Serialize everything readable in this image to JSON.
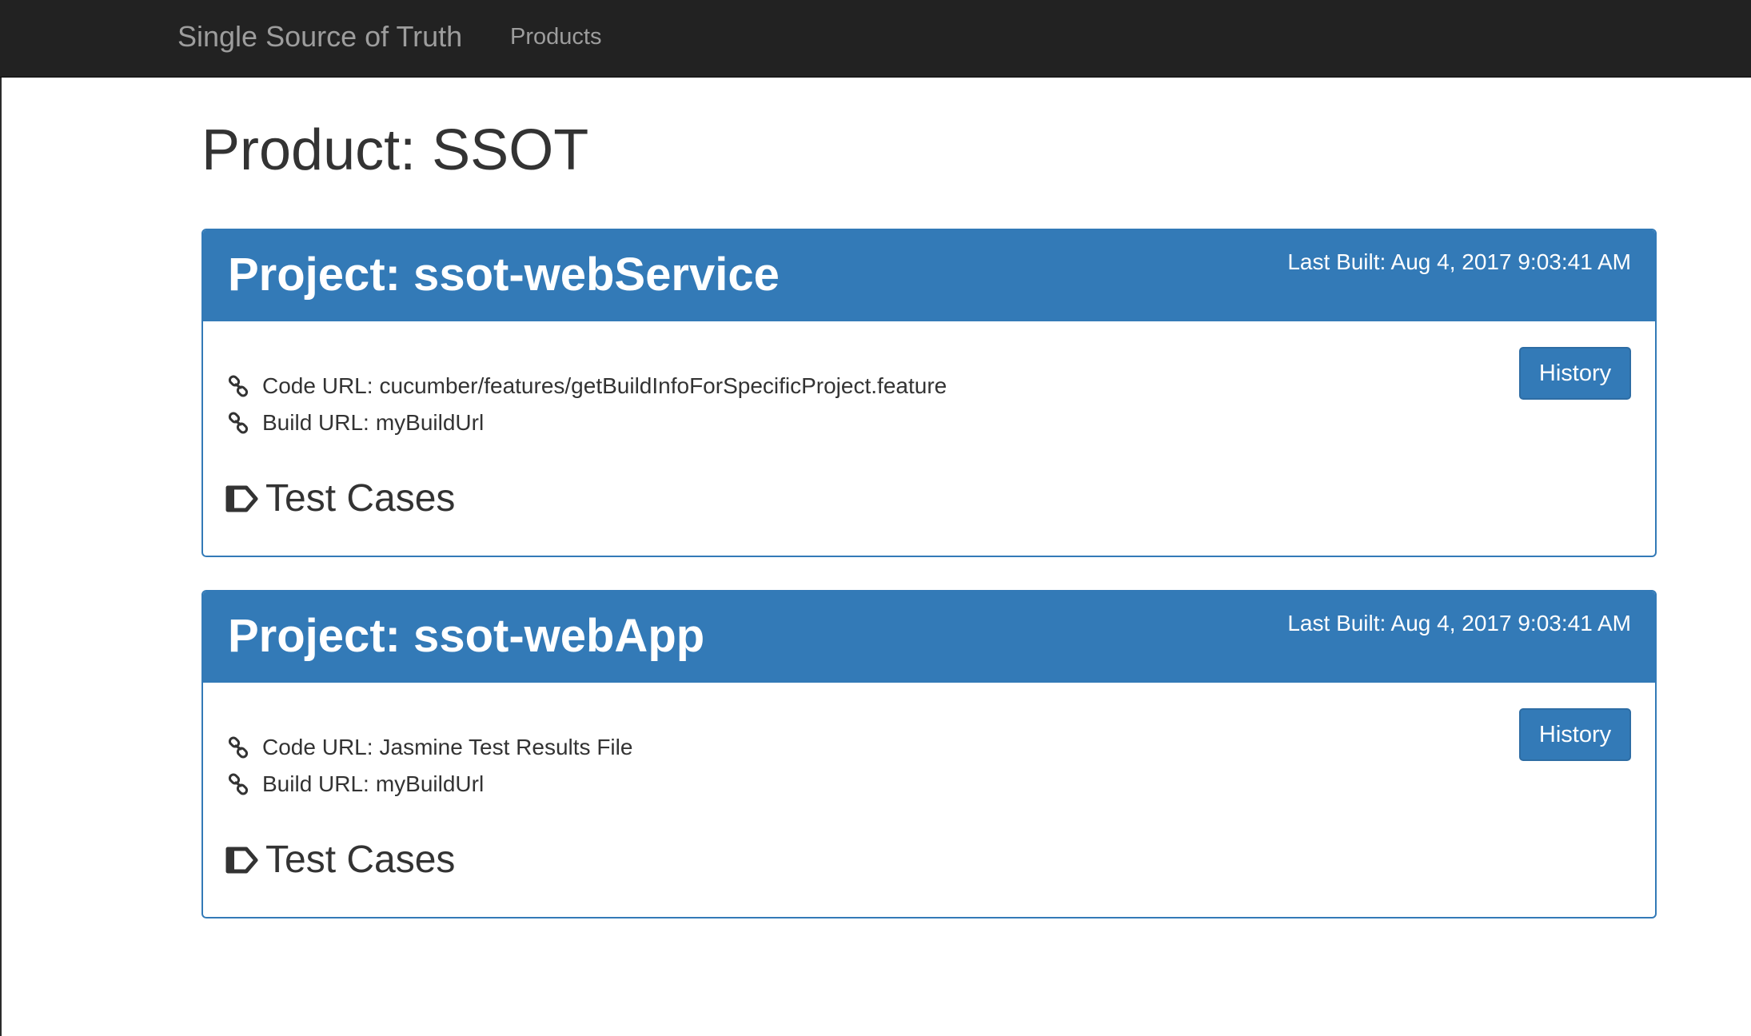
{
  "navbar": {
    "brand": "Single Source of Truth",
    "links": [
      {
        "label": "Products"
      }
    ]
  },
  "page": {
    "title": "Product: SSOT"
  },
  "projects": [
    {
      "title": "Project: ssot-webService",
      "last_built": "Last Built: Aug 4, 2017 9:03:41 AM",
      "history_label": "History",
      "code_url_label": "Code URL:",
      "code_url_value": "cucumber/features/getBuildInfoForSpecificProject.feature",
      "build_url_label": "Build URL:",
      "build_url_value": "myBuildUrl",
      "test_cases_label": "Test Cases"
    },
    {
      "title": "Project: ssot-webApp",
      "last_built": "Last Built: Aug 4, 2017 9:03:41 AM",
      "history_label": "History",
      "code_url_label": "Code URL:",
      "code_url_value": "Jasmine Test Results File",
      "build_url_label": "Build URL:",
      "build_url_value": "myBuildUrl",
      "test_cases_label": "Test Cases"
    }
  ],
  "icons": {
    "url": "link-icon",
    "section": "tag-icon"
  },
  "colors": {
    "navbar_bg": "#222222",
    "navbar_text": "#9d9d9d",
    "primary": "#337ab7",
    "text": "#333333"
  }
}
